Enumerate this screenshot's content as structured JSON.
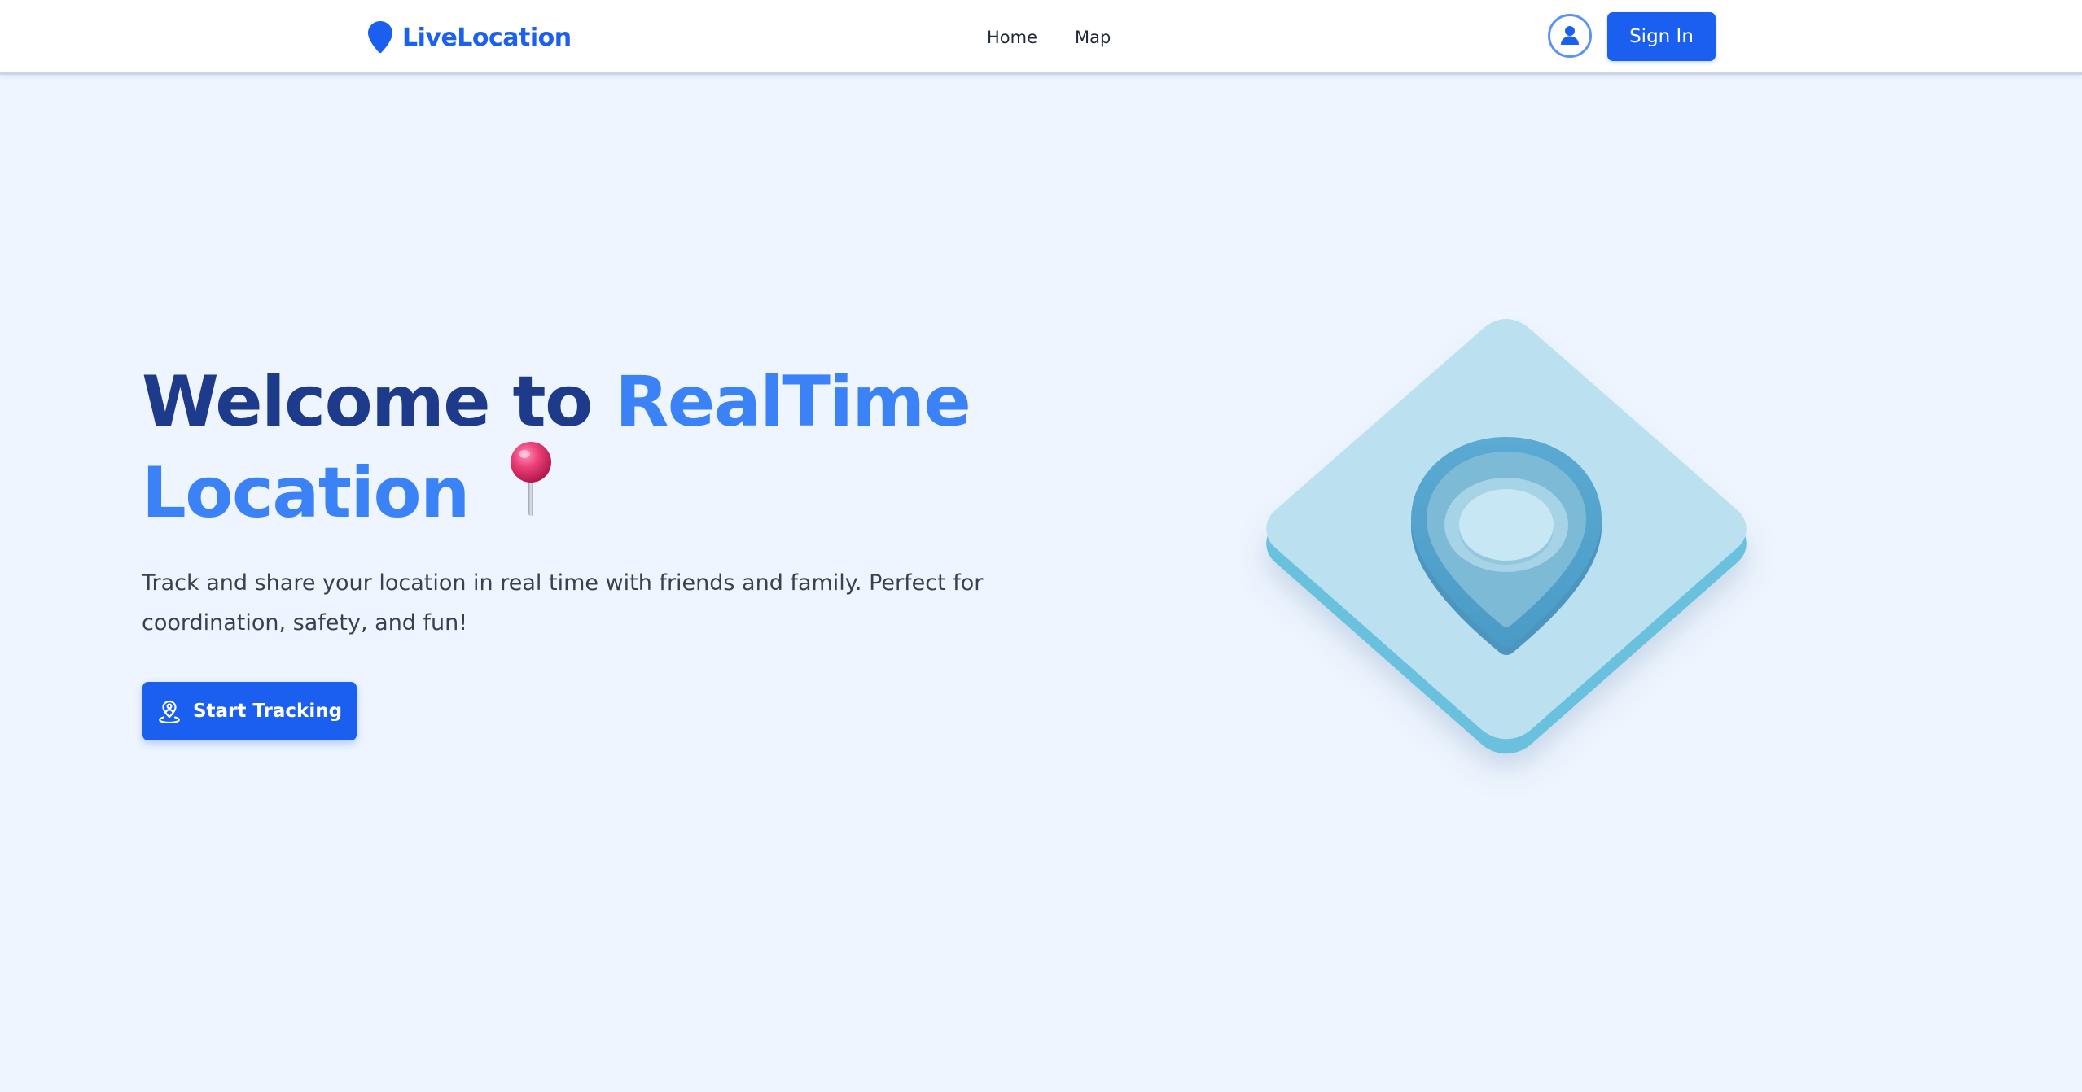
{
  "header": {
    "brand": {
      "name": "LiveLocation",
      "icon": "map-pin-icon"
    },
    "nav": [
      {
        "label": "Home"
      },
      {
        "label": "Map"
      }
    ],
    "user_icon": "user-circle-icon",
    "signin_label": "Sign In"
  },
  "hero": {
    "title_part1": "Welcome to ",
    "title_accent_line1": "RealTime",
    "title_accent_line2": "Location",
    "title_emoji_icon": "round-pushpin-icon",
    "description": "Track and share your location in real time with friends and family. Perfect for coordination, safety, and fun!",
    "cta": {
      "label": "Start Tracking",
      "icon": "user-location-icon"
    },
    "illustration_icon": "isometric-location-pin-icon"
  },
  "colors": {
    "brand_blue": "#1a5ff0",
    "title_dark": "#1e3a8a",
    "title_accent": "#3b82f6",
    "background": "#eef5fe",
    "illustration_tile": "#bbe1f0",
    "illustration_pin": "#5eaed6"
  }
}
